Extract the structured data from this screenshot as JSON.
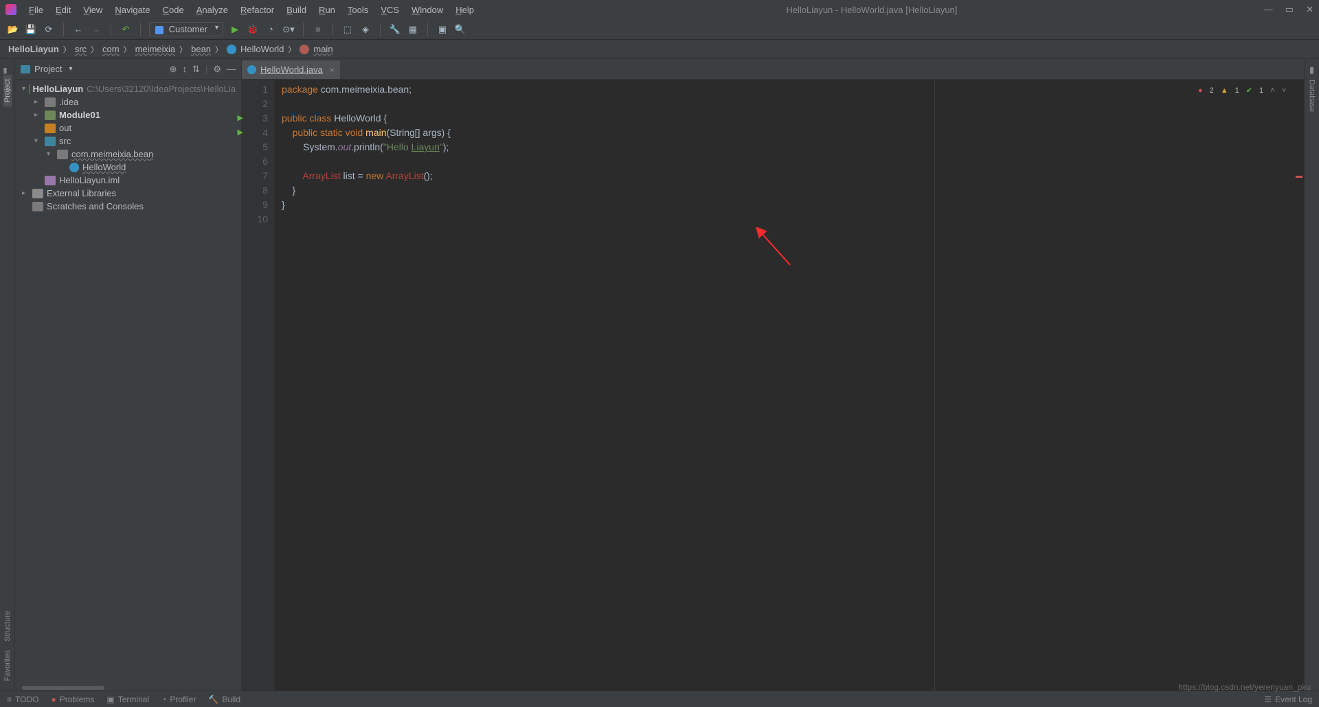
{
  "window_title": "HelloLiayun - HelloWorld.java [HelloLiayun]",
  "menu": [
    "File",
    "Edit",
    "View",
    "Navigate",
    "Code",
    "Analyze",
    "Refactor",
    "Build",
    "Run",
    "Tools",
    "VCS",
    "Window",
    "Help"
  ],
  "combo_value": "Customer",
  "breadcrumb": {
    "root": "HelloLiayun",
    "p1": "src",
    "p2": "com",
    "p3": "meimeixia",
    "p4": "bean",
    "cls": "HelloWorld",
    "method": "main"
  },
  "sidebar": {
    "title": "Project",
    "tree": [
      {
        "depth": 0,
        "exp": "▾",
        "icon": "mod-icon",
        "label": "HelloLiayun",
        "bold": true,
        "hint": "C:\\Users\\32120\\IdeaProjects\\HelloLia"
      },
      {
        "depth": 1,
        "exp": "▸",
        "icon": "folder-grey",
        "label": ".idea"
      },
      {
        "depth": 1,
        "exp": "▸",
        "icon": "mod-icon",
        "label": "Module01",
        "bold": true
      },
      {
        "depth": 1,
        "exp": "",
        "icon": "folder-orange",
        "label": "out"
      },
      {
        "depth": 1,
        "exp": "▾",
        "icon": "folder-blue",
        "label": "src"
      },
      {
        "depth": 2,
        "exp": "▾",
        "icon": "folder-grey",
        "label": "com.meimeixia.bean",
        "wavy": true
      },
      {
        "depth": 3,
        "exp": "",
        "icon": "file-c",
        "label": "HelloWorld",
        "wavy": true
      },
      {
        "depth": 1,
        "exp": "",
        "icon": "file-iml",
        "label": "HelloLiayun.iml"
      },
      {
        "depth": 0,
        "exp": "▸",
        "icon": "lib-icon",
        "label": "External Libraries"
      },
      {
        "depth": 0,
        "exp": "",
        "icon": "folder-grey",
        "label": "Scratches and Consoles"
      }
    ]
  },
  "tab": {
    "file": "HelloWorld.java"
  },
  "code_lines": [
    {
      "n": 1,
      "segs": [
        [
          "kw",
          "package "
        ],
        [
          "cls",
          "com.meimeixia.bean"
        ],
        [
          "",
          ";"
        ]
      ]
    },
    {
      "n": 2,
      "segs": []
    },
    {
      "n": 3,
      "run": true,
      "segs": [
        [
          "kw",
          "public class "
        ],
        [
          "cls",
          "HelloWorld "
        ],
        [
          "",
          "{"
        ]
      ]
    },
    {
      "n": 4,
      "run": true,
      "segs": [
        [
          "",
          "    "
        ],
        [
          "kw",
          "public static void "
        ],
        [
          "fn",
          "main"
        ],
        [
          "",
          "(String[] args) {"
        ]
      ]
    },
    {
      "n": 5,
      "segs": [
        [
          "",
          "        System."
        ],
        [
          "fld",
          "out"
        ],
        [
          "",
          ".println("
        ],
        [
          "str",
          "\"Hello "
        ],
        [
          "str und",
          "Liayun"
        ],
        [
          "str",
          "\""
        ],
        [
          "",
          ");"
        ]
      ]
    },
    {
      "n": 6,
      "segs": []
    },
    {
      "n": 7,
      "cur": true,
      "segs": [
        [
          "",
          "        "
        ],
        [
          "err",
          "ArrayList"
        ],
        [
          "",
          " list = "
        ],
        [
          "new",
          "new "
        ],
        [
          "err",
          "ArrayList"
        ],
        [
          "",
          "();"
        ]
      ]
    },
    {
      "n": 8,
      "segs": [
        [
          "",
          "    }"
        ]
      ]
    },
    {
      "n": 9,
      "segs": [
        [
          "",
          "}"
        ]
      ]
    },
    {
      "n": 10,
      "segs": []
    }
  ],
  "inspections": {
    "errors": "2",
    "warnings": "1",
    "weak": "1"
  },
  "left_tools": [
    "Project",
    "Structure",
    "Favorites"
  ],
  "right_tools": [
    "Database"
  ],
  "status": {
    "todo": "TODO",
    "problems": "Problems",
    "terminal": "Terminal",
    "profiler": "Profiler",
    "build": "Build",
    "eventlog": "Event Log"
  },
  "watermark": "https://blog.csdn.net/yerenyuan_pku"
}
